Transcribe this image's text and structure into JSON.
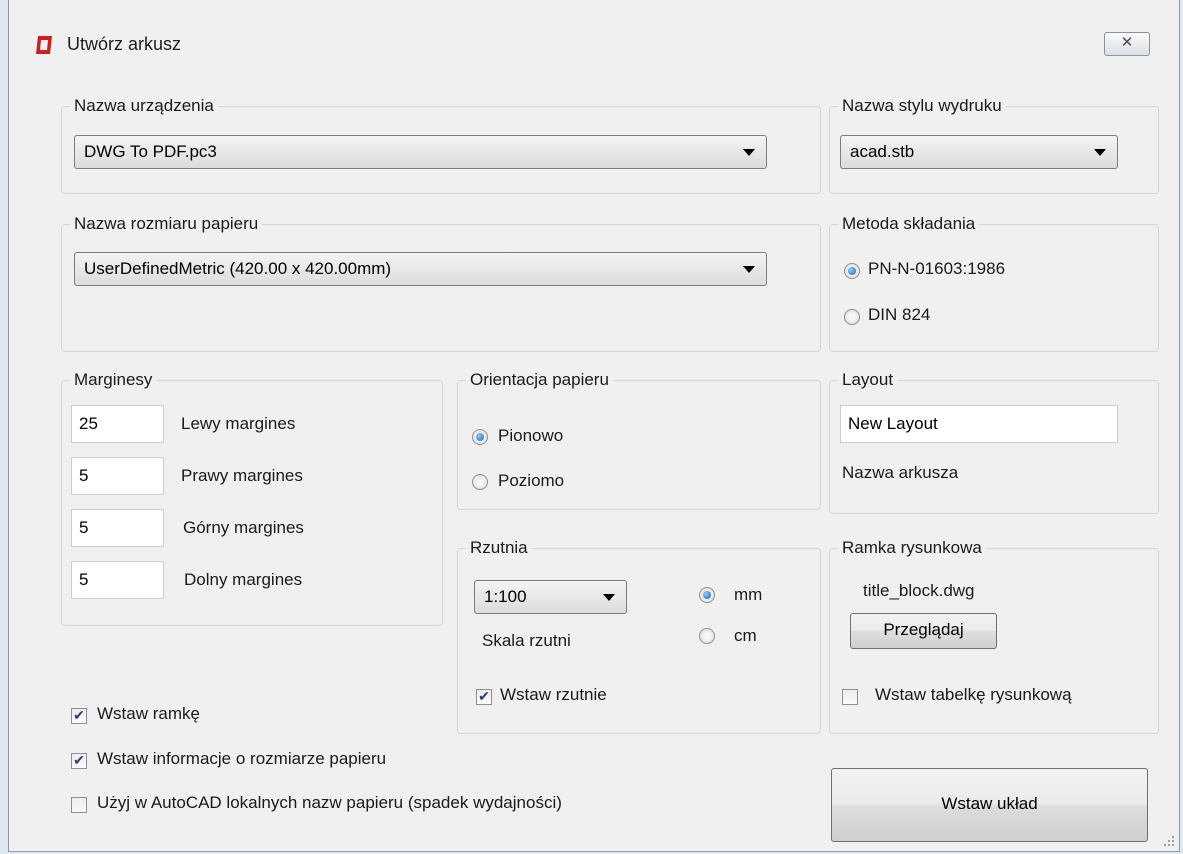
{
  "window": {
    "title": "Utwórz arkusz",
    "close_symbol": "✕",
    "accent_color": "#cc1f1f"
  },
  "device": {
    "label": "Nazwa urządzenia",
    "value": "DWG To PDF.pc3"
  },
  "plot_style": {
    "label": "Nazwa stylu wydruku",
    "value": "acad.stb"
  },
  "paper_size": {
    "label": "Nazwa rozmiaru papieru",
    "value": "UserDefinedMetric (420.00 x 420.00mm)"
  },
  "folding": {
    "label": "Metoda składania",
    "options": [
      "PN-N-01603:1986",
      "DIN 824"
    ],
    "selected": "PN-N-01603:1986"
  },
  "margins": {
    "label": "Marginesy",
    "left": {
      "value": "25",
      "label": "Lewy margines"
    },
    "right": {
      "value": "5",
      "label": "Prawy margines"
    },
    "top": {
      "value": "5",
      "label": "Górny margines"
    },
    "bottom": {
      "value": "5",
      "label": "Dolny margines"
    }
  },
  "orientation": {
    "label": "Orientacja papieru",
    "options": [
      "Pionowo",
      "Poziomo"
    ],
    "selected": "Pionowo"
  },
  "layout": {
    "label": "Layout",
    "value": "New Layout",
    "caption": "Nazwa arkusza"
  },
  "viewport": {
    "label": "Rzutnia",
    "scale_value": "1:100",
    "scale_label": "Skala rzutni",
    "units": [
      "mm",
      "cm"
    ],
    "selected_unit": "mm",
    "insert_label": "Wstaw rzutnie",
    "insert_checked": true
  },
  "frame": {
    "label": "Ramka rysunkowa",
    "file": "title_block.dwg",
    "browse_label": "Przeglądaj",
    "insert_title_label": "Wstaw tabelkę rysunkową",
    "insert_title_checked": false
  },
  "options": {
    "insert_frame": {
      "label": "Wstaw ramkę",
      "checked": true
    },
    "insert_paper_info": {
      "label": "Wstaw informacje o rozmiarze papieru",
      "checked": true
    },
    "local_paper_names": {
      "label": "Użyj w AutoCAD lokalnych nazw papieru (spadek wydajności)",
      "checked": false
    }
  },
  "submit": {
    "label": "Wstaw układ"
  },
  "icons": {
    "app": "app-logo-icon",
    "close": "close-icon",
    "dropdown": "chevron-down-icon",
    "checkmark": "check-icon",
    "resize": "resize-grip-icon"
  }
}
